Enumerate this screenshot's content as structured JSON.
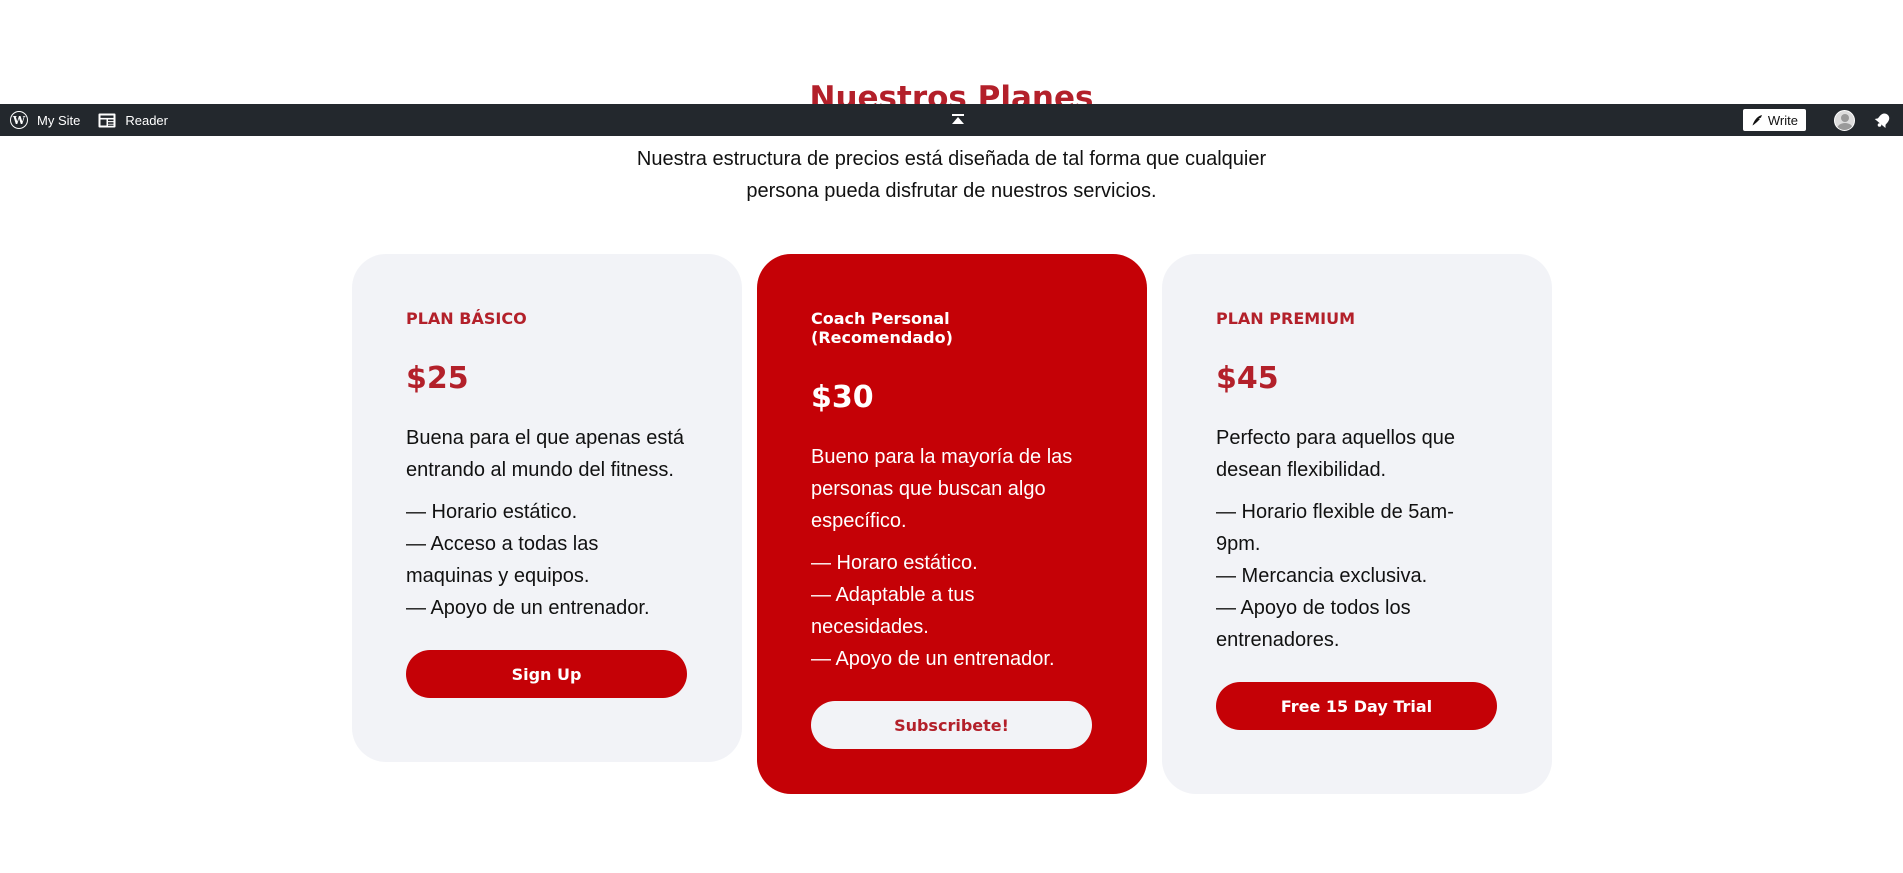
{
  "section": {
    "title": "Nuestros Planes",
    "subtitle_line1": "Nuestra estructura de precios está diseñada de tal forma que cualquier",
    "subtitle_line2": "persona pueda disfrutar de nuestros servicios."
  },
  "adminbar": {
    "my_site": "My Site",
    "reader": "Reader",
    "write": "Write",
    "icons": [
      "wordpress-icon",
      "reader-icon",
      "collapse-icon",
      "pen-icon",
      "avatar",
      "notification-bell-icon"
    ]
  },
  "plans": [
    {
      "name": "PLAN BÁSICO",
      "price": "$25",
      "description": "Buena para el que apenas está entrando al mundo del fitness.",
      "features": [
        "— Horario estático.",
        "— Acceso a todas las maquinas y equipos.",
        "— Apoyo de un entrenador."
      ],
      "button": "Sign Up"
    },
    {
      "name": "Coach Personal (Recomendado)",
      "price": "$30",
      "description": "Bueno para la mayoría de las personas que buscan algo específico.",
      "features": [
        "— Horaro estático.",
        "— Adaptable a tus necesidades.",
        "— Apoyo de un entrenador."
      ],
      "button": "Subscribete!"
    },
    {
      "name": "PLAN PREMIUM",
      "price": "$45",
      "description": "Perfecto para aquellos que desean flexibilidad.",
      "features": [
        "— Horario flexible de 5am-9pm.",
        "— Mercancia exclusiva.",
        "— Apoyo de todos los entrenadores."
      ],
      "button": "Free 15 Day Trial"
    }
  ],
  "colors": {
    "brand_red": "#c50106",
    "title_red": "#b3202a",
    "card_bg": "#f2f3f7",
    "adminbar_bg": "#23282d"
  }
}
